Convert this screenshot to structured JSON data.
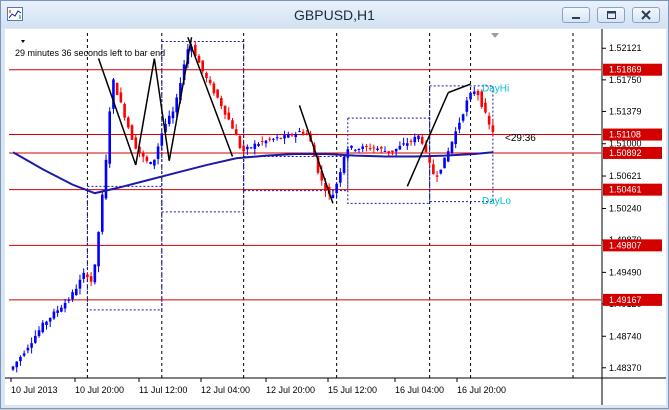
{
  "window": {
    "title": "GBPUSD,H1",
    "bar_countdown": "29 minutes 36 seconds left to bar end",
    "colors": {
      "bull": "#0000ff",
      "bear": "#ff0000",
      "ma": "#1b1ba8",
      "levels": "#d40000",
      "annotation": "#00bcd4",
      "frame": "#7a96bf"
    }
  },
  "chart_data": {
    "type": "candlestick",
    "symbol": "GBPUSD",
    "timeframe": "H1",
    "ylim": [
      1.4825,
      1.523
    ],
    "y_ticks": [
      "1.52121",
      "1.51750",
      "1.51379",
      "1.51000",
      "1.50621",
      "1.50240",
      "1.49870",
      "1.49490",
      "1.49120",
      "1.48740",
      "1.48370"
    ],
    "x_ticks": [
      "10 Jul 2013",
      "10 Jul 20:00",
      "11 Jul 12:00",
      "12 Jul 04:00",
      "12 Jul 20:00",
      "15 Jul 12:00",
      "16 Jul 04:00",
      "16 Jul 20:00"
    ],
    "horizontal_levels": [
      {
        "label": "1.51869",
        "value": 1.51869
      },
      {
        "label": "1.51108",
        "value": 1.51108
      },
      {
        "label": "1.50892",
        "value": 1.50892
      },
      {
        "label": "1.50461",
        "value": 1.50461
      },
      {
        "label": "1.49807",
        "value": 1.49807
      },
      {
        "label": "1.49167",
        "value": 1.49167
      }
    ],
    "annotations": [
      {
        "text": "DayHi",
        "value": 1.5166
      },
      {
        "text": "DayLo",
        "value": 1.5034
      },
      {
        "text": "<29:36",
        "value": 1.5108
      }
    ],
    "current_price_label": "<29:36",
    "anchor_points": [
      {
        "t": 0,
        "p": 1.4835
      },
      {
        "t": 9,
        "p": 1.489
      },
      {
        "t": 16,
        "p": 1.492
      },
      {
        "t": 20,
        "p": 1.495
      },
      {
        "t": 22,
        "p": 1.4935
      },
      {
        "t": 26,
        "p": 1.51
      },
      {
        "t": 27,
        "p": 1.518
      },
      {
        "t": 30,
        "p": 1.514
      },
      {
        "t": 33,
        "p": 1.51
      },
      {
        "t": 36,
        "p": 1.508
      },
      {
        "t": 38,
        "p": 1.5075
      },
      {
        "t": 41,
        "p": 1.512
      },
      {
        "t": 44,
        "p": 1.514
      },
      {
        "t": 46,
        "p": 1.5185
      },
      {
        "t": 48,
        "p": 1.522
      },
      {
        "t": 52,
        "p": 1.518
      },
      {
        "t": 56,
        "p": 1.515
      },
      {
        "t": 60,
        "p": 1.5115
      },
      {
        "t": 62,
        "p": 1.509
      },
      {
        "t": 66,
        "p": 1.51
      },
      {
        "t": 70,
        "p": 1.5105
      },
      {
        "t": 74,
        "p": 1.5108
      },
      {
        "t": 78,
        "p": 1.5115
      },
      {
        "t": 80,
        "p": 1.511
      },
      {
        "t": 83,
        "p": 1.506
      },
      {
        "t": 86,
        "p": 1.5035
      },
      {
        "t": 88,
        "p": 1.506
      },
      {
        "t": 90,
        "p": 1.5095
      },
      {
        "t": 94,
        "p": 1.5095
      },
      {
        "t": 98,
        "p": 1.5095
      },
      {
        "t": 102,
        "p": 1.509
      },
      {
        "t": 106,
        "p": 1.51
      },
      {
        "t": 110,
        "p": 1.511
      },
      {
        "t": 112,
        "p": 1.508
      },
      {
        "t": 114,
        "p": 1.506
      },
      {
        "t": 117,
        "p": 1.5085
      },
      {
        "t": 120,
        "p": 1.512
      },
      {
        "t": 123,
        "p": 1.5155
      },
      {
        "t": 125,
        "p": 1.5165
      },
      {
        "t": 127,
        "p": 1.514
      },
      {
        "t": 129,
        "p": 1.5115
      }
    ],
    "moving_average": [
      {
        "t": 0,
        "p": 1.509
      },
      {
        "t": 8,
        "p": 1.507
      },
      {
        "t": 16,
        "p": 1.5052
      },
      {
        "t": 22,
        "p": 1.5042
      },
      {
        "t": 28,
        "p": 1.5048
      },
      {
        "t": 36,
        "p": 1.5057
      },
      {
        "t": 44,
        "p": 1.5066
      },
      {
        "t": 52,
        "p": 1.5075
      },
      {
        "t": 60,
        "p": 1.5083
      },
      {
        "t": 68,
        "p": 1.5086
      },
      {
        "t": 76,
        "p": 1.5088
      },
      {
        "t": 84,
        "p": 1.5088
      },
      {
        "t": 92,
        "p": 1.5086
      },
      {
        "t": 100,
        "p": 1.5085
      },
      {
        "t": 108,
        "p": 1.5085
      },
      {
        "t": 116,
        "p": 1.5086
      },
      {
        "t": 124,
        "p": 1.5088
      },
      {
        "t": 129,
        "p": 1.509
      }
    ],
    "trend_lines": [
      {
        "t1": 23,
        "p1": 1.52,
        "t2": 33,
        "p2": 1.5075
      },
      {
        "t1": 33,
        "p1": 1.5075,
        "t2": 38,
        "p2": 1.52
      },
      {
        "t1": 38,
        "p1": 1.52,
        "t2": 42,
        "p2": 1.508
      },
      {
        "t1": 42,
        "p1": 1.508,
        "t2": 48,
        "p2": 1.5225
      },
      {
        "t1": 47,
        "p1": 1.5225,
        "t2": 59,
        "p2": 1.5085
      },
      {
        "t1": 77,
        "p1": 1.5145,
        "t2": 86,
        "p2": 1.503
      },
      {
        "t1": 106,
        "p1": 1.505,
        "t2": 117,
        "p2": 1.516
      },
      {
        "t1": 117,
        "p1": 1.516,
        "t2": 123,
        "p2": 1.517
      }
    ],
    "day_boxes": [
      {
        "t1": 20,
        "t2": 40,
        "p1": 1.4905,
        "p2": 1.505
      },
      {
        "t1": 40,
        "t2": 62,
        "p1": 1.502,
        "p2": 1.522
      },
      {
        "t1": 62,
        "t2": 90,
        "p1": 1.5045,
        "p2": 1.5085
      },
      {
        "t1": 90,
        "t2": 112,
        "p1": 1.503,
        "p2": 1.513
      },
      {
        "t1": 112,
        "t2": 129,
        "p1": 1.5032,
        "p2": 1.5168
      }
    ],
    "grid_dates_t": [
      20,
      40,
      62,
      87,
      112,
      123
    ]
  }
}
